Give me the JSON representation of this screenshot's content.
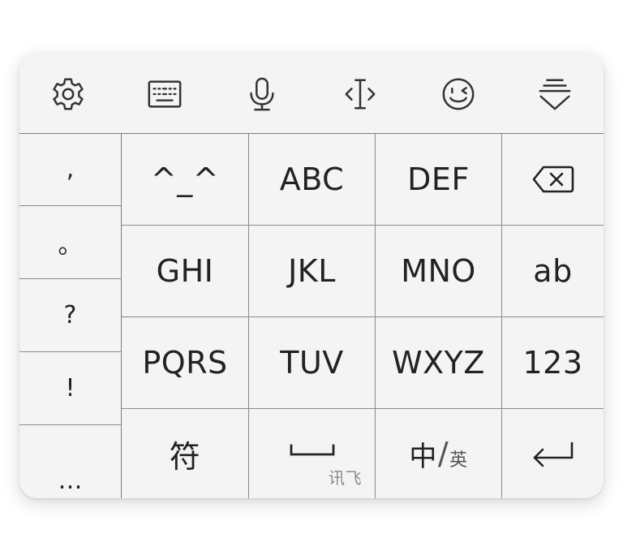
{
  "toolbar": {
    "icons": [
      "gear-icon",
      "keyboard-icon",
      "microphone-icon",
      "cursor-move-icon",
      "wink-emoji-icon",
      "collapse-keyboard-icon"
    ]
  },
  "punctuation": [
    ",",
    "。",
    "?",
    "!",
    "…"
  ],
  "keys": {
    "emoticon": "^_^",
    "abc": "ABC",
    "def": "DEF",
    "ghi": "GHI",
    "jkl": "JKL",
    "mno": "MNO",
    "ab": "ab",
    "pqrs": "PQRS",
    "tuv": "TUV",
    "wxyz": "WXYZ",
    "num": "123",
    "symbol": "符",
    "space_brand": "讯飞",
    "lang_zh": "中",
    "lang_sep": "/",
    "lang_en": "英"
  },
  "colors": {
    "background": "#f4f4f4",
    "text": "#222222",
    "divider": "#8a8a8a"
  }
}
